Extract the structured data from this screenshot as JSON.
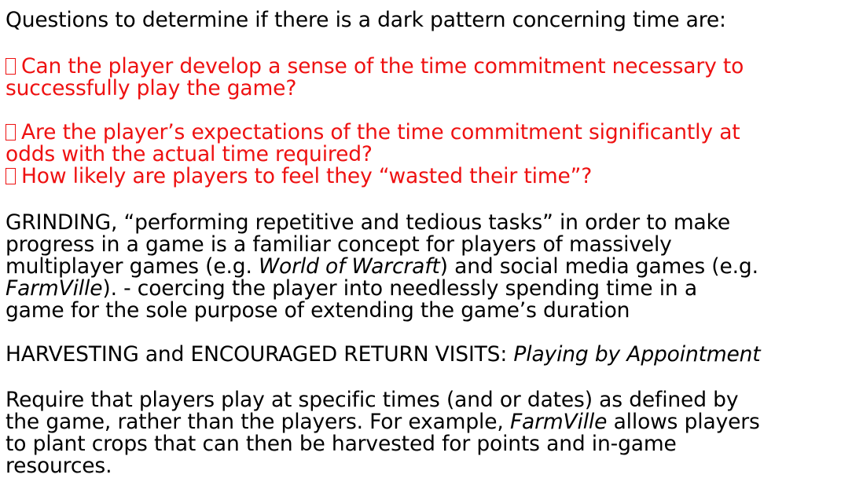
{
  "heading": "Questions to determine if there is a dark pattern concerning time are:",
  "questions": [
    {
      "line1": "Can the player develop a sense of the time commitment necessary to",
      "line2": "successfully play the game?"
    },
    {
      "line1": "Are the player’s expectations of the time commitment significantly at",
      "line2": "odds with the actual time required?"
    },
    {
      "line1": "How likely are players to feel they “wasted their time”?"
    }
  ],
  "grinding": {
    "line1": "GRINDING,  “performing repetitive and tedious tasks” in order to make",
    "line2": "progress in a game is a familiar concept for players of massively",
    "line3_a": "multiplayer games (e.g. ",
    "line3_game": "World of Warcraft",
    "line3_b": ") and social media games (e.g.",
    "line4_game": "FarmVille",
    "line4_b": ").  - coercing the player into needlessly spending time in a",
    "line5": "game for the sole purpose of extending the game’s duration"
  },
  "harvesting": {
    "label": "HARVESTING and ENCOURAGED RETURN VISITS: ",
    "title": "Playing by Appointment"
  },
  "require": {
    "line1": "Require that players play at specific times (and or dates) as defined by",
    "line2_a": "the game, rather than the players. For example, ",
    "line2_game": "FarmVille",
    "line2_b": " allows players",
    "line3": "to plant crops that can then be harvested for points and in-game",
    "line4": "resources."
  },
  "colors": {
    "question_text": "#ee1111",
    "body_text": "#000000",
    "background": "#ffffff"
  },
  "icons": {
    "question_bullet": "hollow-square-bullet"
  }
}
